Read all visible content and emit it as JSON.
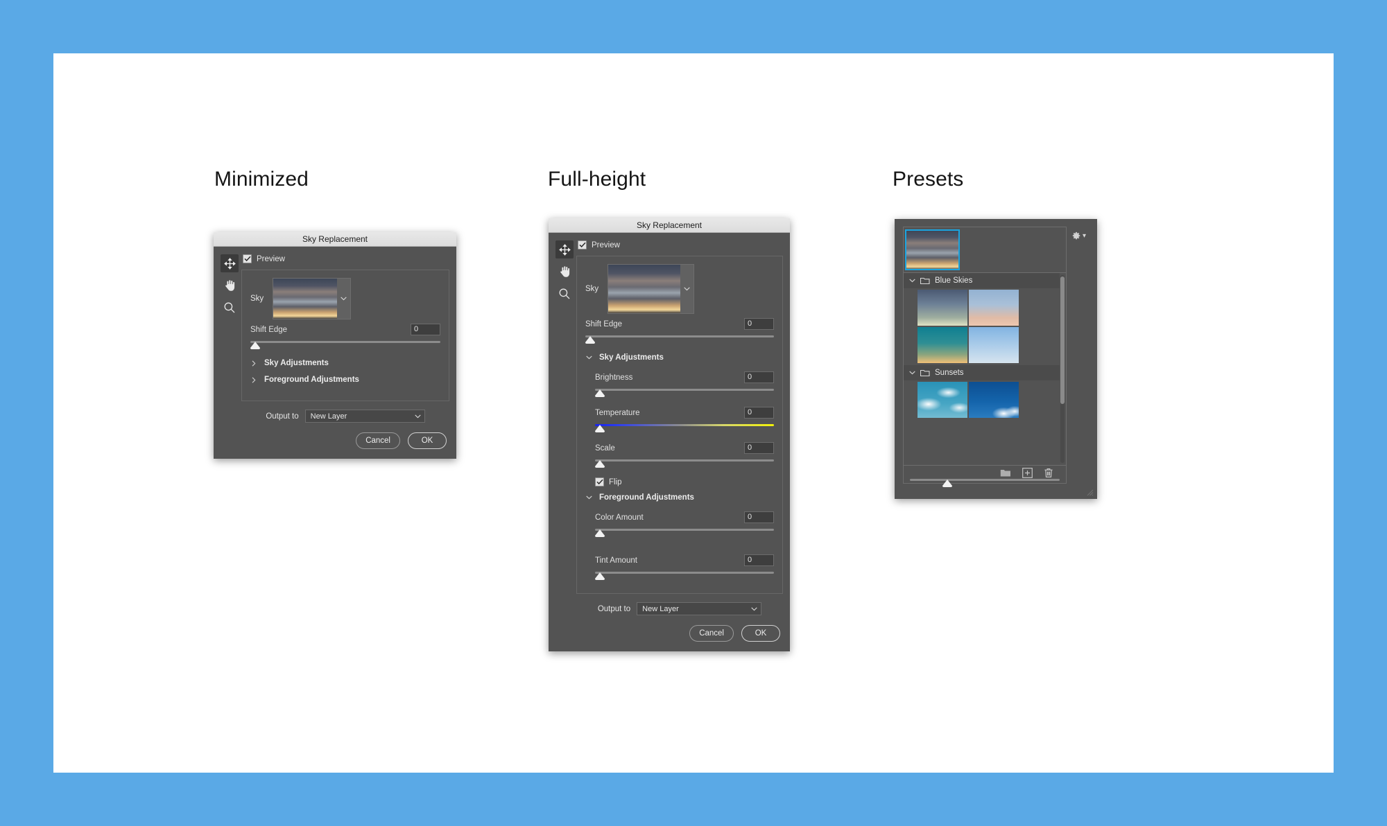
{
  "page": {
    "background_color": "#5aa9e6",
    "card_color": "#ffffff"
  },
  "columns": [
    {
      "title": "Minimized"
    },
    {
      "title": "Full-height"
    },
    {
      "title": "Presets"
    }
  ],
  "dialog": {
    "title": "Sky Replacement",
    "preview_label": "Preview",
    "tools": [
      {
        "name": "move-tool",
        "active": true
      },
      {
        "name": "hand-tool",
        "active": false
      },
      {
        "name": "zoom-tool",
        "active": false
      }
    ],
    "sky_label": "Sky",
    "shift_edge": {
      "label": "Shift Edge",
      "value": "0"
    },
    "sections": {
      "sky_adjustments": "Sky Adjustments",
      "foreground_adjustments": "Foreground Adjustments"
    },
    "sky_sliders": [
      {
        "label": "Brightness",
        "value": "0",
        "style": "plain"
      },
      {
        "label": "Temperature",
        "value": "0",
        "style": "temperature"
      },
      {
        "label": "Scale",
        "value": "0",
        "style": "plain"
      }
    ],
    "flip": {
      "label": "Flip",
      "checked": true
    },
    "foreground_sliders": [
      {
        "label": "Color Amount",
        "value": "0",
        "style": "plain"
      },
      {
        "label": "Tint Amount",
        "value": "0",
        "style": "plain"
      }
    ],
    "output": {
      "label": "Output to",
      "value": "New Layer"
    },
    "buttons": {
      "cancel": "Cancel",
      "ok": "OK"
    }
  },
  "minimized": {
    "collapsed_sections": [
      "Sky Adjustments",
      "Foreground Adjustments"
    ]
  },
  "presets": {
    "groups": [
      {
        "name": "Blue Skies",
        "expanded": true,
        "thumbs": [
          {
            "name": "dusk-clear-sky",
            "css": "linear-gradient(to bottom,#4b5a73 0%,#6d8096 40%,#9fae9f 78%,#dfe2c4 100%)"
          },
          {
            "name": "pastel-horizon-sky",
            "css": "linear-gradient(to bottom,#93b2d2 0%,#a9c0d8 42%,#e0bba6 78%,#eec8b0 100%)"
          },
          {
            "name": "teal-sunset-sky",
            "css": "linear-gradient(to bottom,#0f7f92 0%,#2f8f94 45%,#8aa47e 76%,#f0c077 100%)"
          },
          {
            "name": "soft-blue-sky",
            "css": "linear-gradient(to bottom,#82b4e2 0%,#a9cbe9 48%,#d6e4ef 100%)"
          }
        ]
      },
      {
        "name": "Sunsets",
        "expanded": true,
        "thumbs": [
          {
            "name": "cumulus-clouds-sky",
            "css": "linear-gradient(to bottom,#2a93b8 0%,#46a5c4 60%,#74bcd2 100%)"
          },
          {
            "name": "deep-blue-clouds-sky",
            "css": "linear-gradient(to bottom,#0d4f92 0%,#1464ab 55%,#2a7cc0 100%)"
          }
        ]
      }
    ],
    "toolbar_icons": [
      "new-folder-icon",
      "new-preset-icon",
      "delete-preset-icon"
    ],
    "gear_icon": "gear-icon",
    "accent_color": "#1ba5e0",
    "zoom_slider_value": 25
  }
}
